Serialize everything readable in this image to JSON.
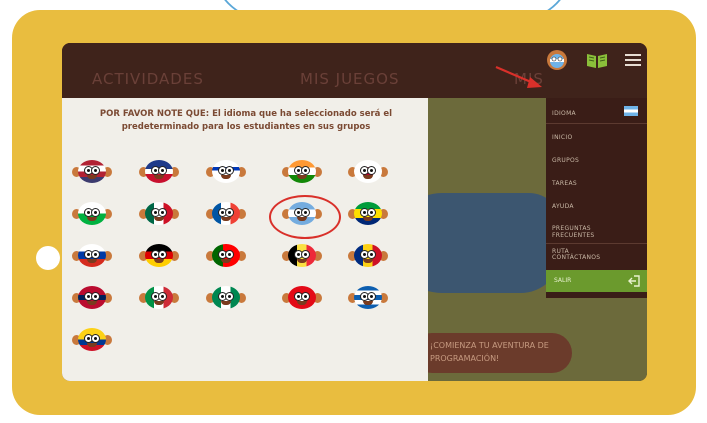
{
  "app": {
    "nav_tabs": [
      "ACTIVIDADES",
      "MIS JUEGOS",
      "MIS"
    ],
    "notice": "POR FAVOR NOTE QUE: El idioma que ha seleccionado será el predeterminado para los estudiantes en sus grupos",
    "banner_text": "¡COMIENZA TU AVENTURA DE PROGRAMACIÓN!"
  },
  "menu": {
    "items": [
      "IDIOMA",
      "INICIO",
      "GRUPOS",
      "TAREAS",
      "AYUDA",
      "PREGUNTAS FRECUENTES",
      "RUTA",
      "CONTÁCTANOS"
    ],
    "exit_label": "SALIR",
    "selected_flag": "argentina-flag"
  },
  "languages": {
    "count": 21,
    "selected_index": 8,
    "flags": [
      "usa",
      "uk",
      "israel",
      "india",
      "japan",
      "wales",
      "mexico",
      "france",
      "argentina",
      "brazil",
      "russia",
      "germany",
      "portugal",
      "belgium",
      "romania",
      "norway",
      "italy",
      "nigeria",
      "turkey",
      "greece",
      "colombia"
    ]
  },
  "colors": {
    "tablet": "#e9bd3f",
    "screen_bg": "#4b2a22",
    "highlight": "#d9302a",
    "menu_bg": "#3a1d17",
    "exit_green": "#6b9a2d"
  }
}
